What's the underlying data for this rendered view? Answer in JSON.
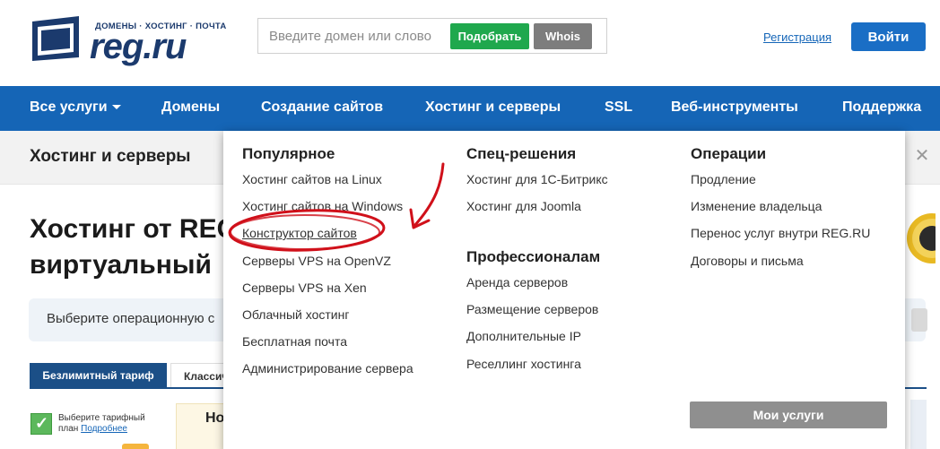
{
  "header": {
    "logo_tagline": "ДОМЕНЫ · ХОСТИНГ · ПОЧТА",
    "logo_text": "reg.ru",
    "search_placeholder": "Введите домен или слово",
    "search_button": "Подобрать",
    "whois_button": "Whois",
    "register_link": "Регистрация",
    "login_button": "Войти"
  },
  "nav": {
    "items": [
      {
        "label": "Все услуги"
      },
      {
        "label": "Домены"
      },
      {
        "label": "Создание сайтов"
      },
      {
        "label": "Хостинг и серверы"
      },
      {
        "label": "SSL"
      },
      {
        "label": "Веб-инструменты"
      },
      {
        "label": "Поддержка"
      }
    ]
  },
  "subbar": {
    "title": "Хостинг и серверы",
    "close_icon": "close-icon"
  },
  "page": {
    "hero_line1": "Хостинг от REG",
    "hero_line2": "виртуальный",
    "os_prompt": "Выберите операционную с",
    "tabs": [
      {
        "label": "Безлимитный тариф"
      },
      {
        "label": "Классич"
      }
    ],
    "plan_hint_line1": "Выберите тарифный",
    "plan_hint_line2": "план",
    "plan_hint_link": "Подробнее",
    "plan_card_text": "Но"
  },
  "dropdown": {
    "popular": {
      "title": "Популярное",
      "links": [
        "Хостинг сайтов на Linux",
        "Хостинг сайтов на Windows",
        "Конструктор сайтов",
        "Серверы VPS на OpenVZ",
        "Серверы VPS на Xen",
        "Облачный хостинг",
        "Бесплатная почта",
        "Администрирование сервера"
      ]
    },
    "special": {
      "title": "Спец-решения",
      "links": [
        "Хостинг для 1С-Битрикс",
        "Хостинг для Joomla"
      ]
    },
    "pro": {
      "title": "Профессионалам",
      "links": [
        "Аренда серверов",
        "Размещение серверов",
        "Дополнительные IP",
        "Реселлинг хостинга"
      ]
    },
    "operations": {
      "title": "Операции",
      "links": [
        "Продление",
        "Изменение владельца",
        "Перенос услуг внутри REG.RU",
        "Договоры и письма"
      ]
    },
    "my_services_button": "Мои услуги"
  },
  "colors": {
    "nav_blue": "#1565b6",
    "accent_green": "#1fa84d",
    "annotation_red": "#d0101a"
  }
}
